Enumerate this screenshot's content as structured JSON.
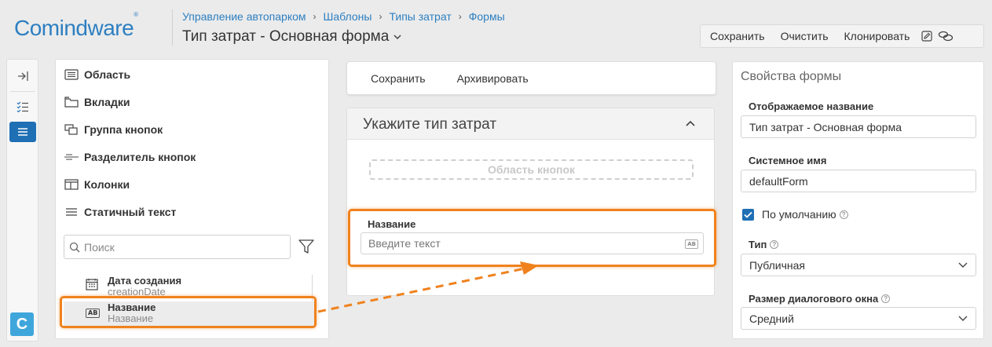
{
  "header": {
    "logo_text": "Comindware",
    "logo_mark": "®",
    "breadcrumb": [
      "Управление автопарком",
      "Шаблоны",
      "Типы затрат",
      "Формы"
    ],
    "breadcrumb_separator": "›",
    "page_title": "Тип затрат - Основная форма",
    "toolbar": {
      "save": "Сохранить",
      "clear": "Очистить",
      "clone": "Клонировать",
      "icons": [
        "edit-icon",
        "link-icon"
      ]
    }
  },
  "rail": {
    "icons": [
      "collapse-panel-icon",
      "checklist-icon",
      "list-icon"
    ],
    "active": "list-icon",
    "brand_letter": "C"
  },
  "components": {
    "items": [
      {
        "label": "Область",
        "icon": "area-icon"
      },
      {
        "label": "Вкладки",
        "icon": "tabs-icon"
      },
      {
        "label": "Группа кнопок",
        "icon": "button-group-icon"
      },
      {
        "label": "Разделитель кнопок",
        "icon": "button-separator-icon"
      },
      {
        "label": "Колонки",
        "icon": "columns-icon"
      },
      {
        "label": "Статичный текст",
        "icon": "static-text-icon"
      }
    ],
    "search_placeholder": "Поиск",
    "fields": [
      {
        "name": "Дата создания",
        "system_name": "creationDate",
        "icon": "calendar-icon"
      },
      {
        "name": "Название",
        "system_name": "Название",
        "icon": "text-field-icon",
        "badge": "AB"
      }
    ]
  },
  "center": {
    "toolbar": {
      "save": "Сохранить",
      "archive": "Архивировать"
    },
    "form": {
      "title": "Укажите тип затрат",
      "button_area": "Область кнопок",
      "field_label": "Название",
      "field_placeholder": "Введите текст",
      "field_badge": "AB"
    }
  },
  "properties": {
    "title": "Свойства формы",
    "display_name_label": "Отображаемое название",
    "display_name_value": "Тип затрат - Основная форма",
    "system_name_label": "Системное имя",
    "system_name_value": "defaultForm",
    "default_label": "По умолчанию",
    "default_checked": true,
    "type_label": "Тип",
    "type_value": "Публичная",
    "dialog_size_label": "Размер диалогового окна",
    "dialog_size_value": "Средний",
    "help_glyph": "?"
  },
  "colors": {
    "accent": "#1f6fb5",
    "brand": "#2d7fc1",
    "highlight": "#f0821e"
  }
}
